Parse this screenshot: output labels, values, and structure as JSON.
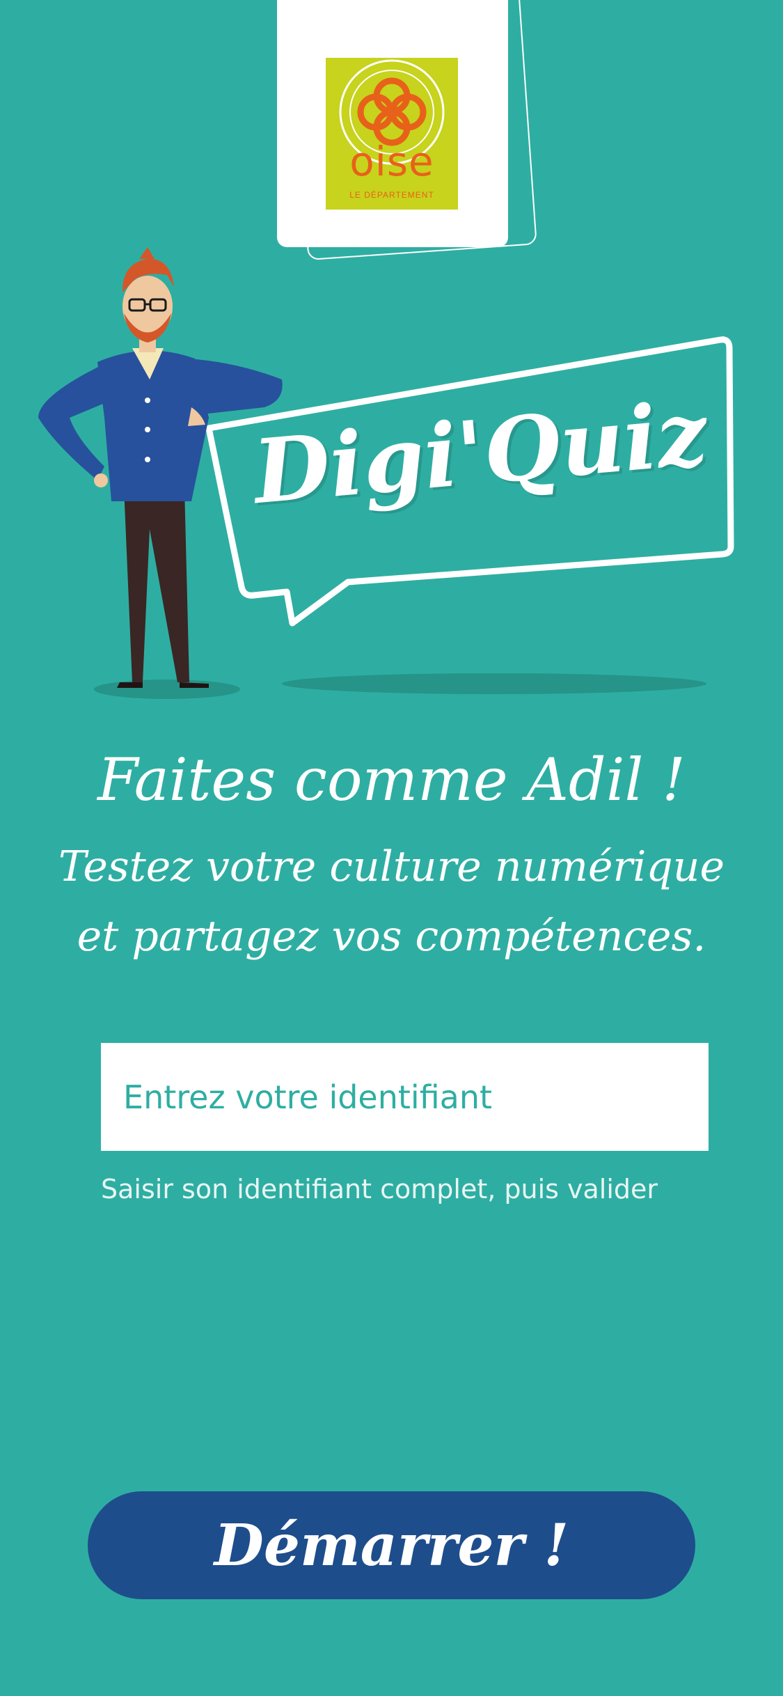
{
  "logo": {
    "name": "oise",
    "subtitle": "LE DÉPARTEMENT",
    "background_color": "#c7d31c",
    "accent_color": "#e8611a"
  },
  "hero": {
    "title": "Digi'Quiz",
    "character": "character-illustration"
  },
  "intro": {
    "headline": "Faites comme Adil !",
    "line1": "Testez votre culture numérique",
    "line2": "et partagez vos compétences."
  },
  "form": {
    "identifier_placeholder": "Entrez votre identifiant",
    "identifier_value": "",
    "hint": "Saisir son identifiant complet, puis valider"
  },
  "actions": {
    "start_label": "Démarrer !"
  },
  "colors": {
    "background": "#2eaea2",
    "button": "#1e4d8c",
    "text": "#ffffff"
  }
}
